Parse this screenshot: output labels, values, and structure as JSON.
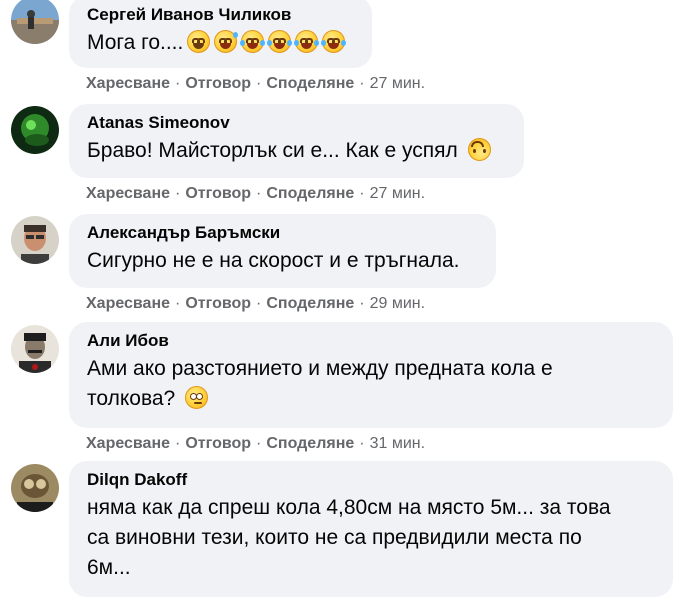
{
  "actions": {
    "like": "Харесване",
    "reply": "Отговор",
    "share": "Споделяне",
    "separator": "·"
  },
  "comments": [
    {
      "author": "Сергей Иванов Чиликов",
      "text": "Мога го....",
      "emojis": [
        "smile-emoji",
        "sweat-smile-emoji",
        "joy-emoji",
        "joy-emoji",
        "joy-emoji",
        "joy-emoji"
      ],
      "time": "27 мин."
    },
    {
      "author": "Atanas Simeonov",
      "text": "Браво! Майсторлък си е... Как е успял",
      "emojis": [
        "upside-down-face-emoji"
      ],
      "time": "27 мин."
    },
    {
      "author": "Александър Баръмски",
      "text": "Сигурно не е на скорост и е тръгнала.",
      "emojis": [],
      "time": "29 мин."
    },
    {
      "author": "Али Ибов",
      "text_line1": "Ами ако разстоянието и между предната кола е",
      "text_line2": "толкова?",
      "emojis": [
        "rolling-eyes-emoji"
      ],
      "time": "31 мин."
    },
    {
      "author": "Dilqn Dakoff",
      "text_line1": "няма как да спреш кола 4,80см на място 5м... за това",
      "text_line2": "са виновни тези, които не са предвидили места по",
      "text_line3": "6м...",
      "emojis": [],
      "time": ""
    }
  ]
}
